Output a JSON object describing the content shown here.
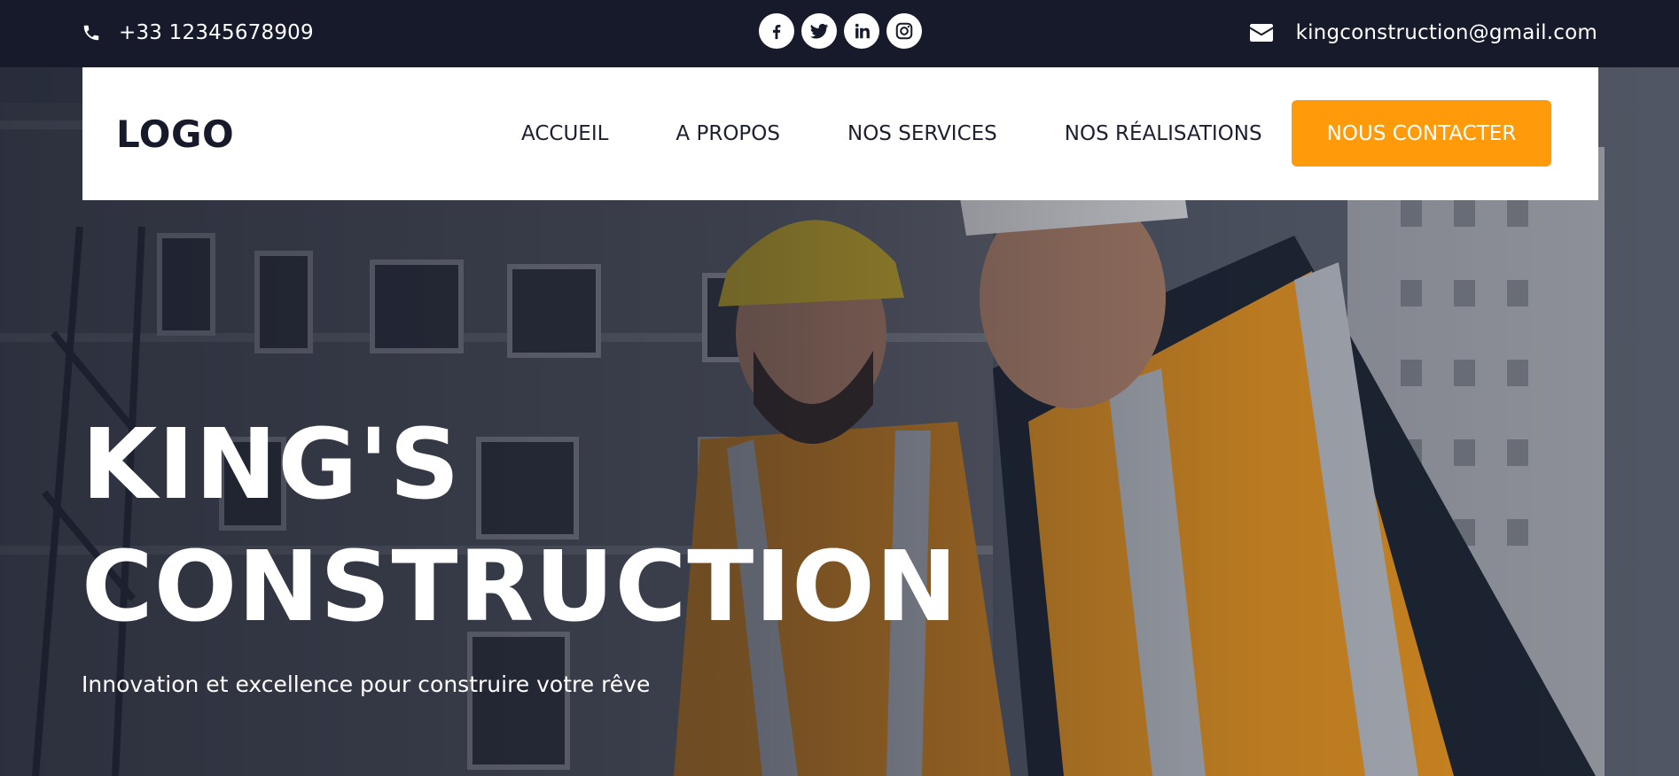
{
  "topbar": {
    "phone": "+33 12345678909",
    "email": "kingconstruction@gmail.com",
    "socials": [
      {
        "icon": "facebook-icon"
      },
      {
        "icon": "twitter-icon"
      },
      {
        "icon": "linkedin-icon"
      },
      {
        "icon": "instagram-icon"
      }
    ]
  },
  "navbar": {
    "logo": "LOGO",
    "links": [
      "ACCUEIL",
      "A PROPOS",
      "NOS SERVICES",
      "NOS RÉALISATIONS"
    ],
    "cta": "NOUS CONTACTER"
  },
  "hero": {
    "title_line1": "KING'S",
    "title_line2": "CONSTRUCTION",
    "subtitle": "Innovation et excellence pour construire votre rêve"
  },
  "colors": {
    "dark": "#161a2b",
    "accent": "#ff9a0a",
    "white": "#ffffff"
  }
}
